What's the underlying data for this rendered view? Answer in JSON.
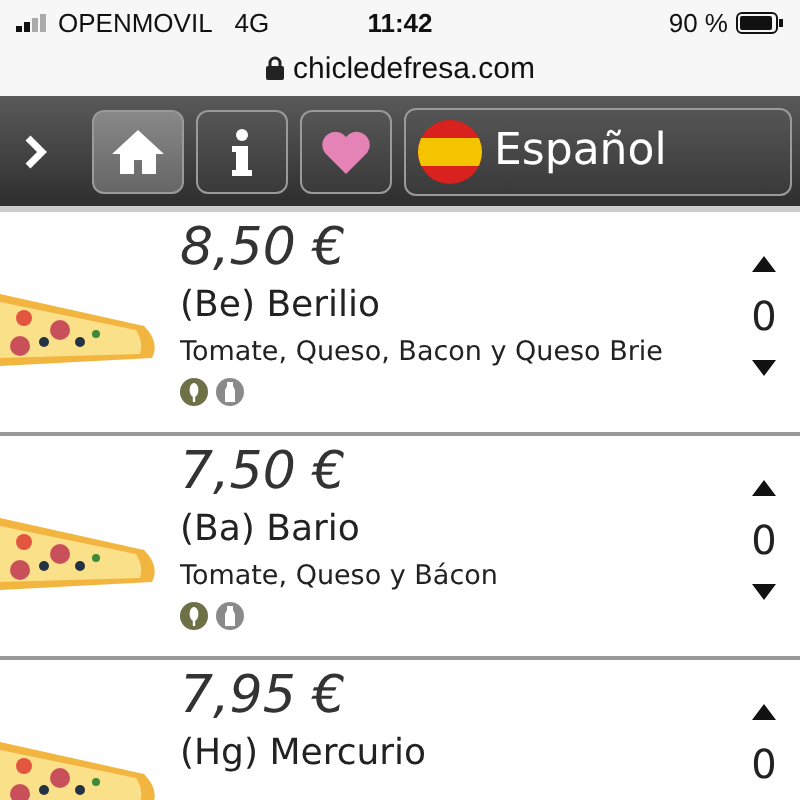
{
  "status_bar": {
    "carrier": "OPENMOVIL",
    "network": "4G",
    "time": "11:42",
    "battery": "90 %"
  },
  "address_bar": {
    "url": "chicledefresa.com"
  },
  "nav": {
    "language": "Español"
  },
  "items": [
    {
      "price": "8,50 €",
      "name": "(Be) Berilio",
      "description": "Tomate, Queso, Bacon y Queso Brie",
      "quantity": "0"
    },
    {
      "price": "7,50 €",
      "name": "(Ba) Bario",
      "description": "Tomate, Queso y Bácon",
      "quantity": "0"
    },
    {
      "price": "7,95 €",
      "name": "(Hg) Mercurio",
      "quantity": "0"
    }
  ]
}
